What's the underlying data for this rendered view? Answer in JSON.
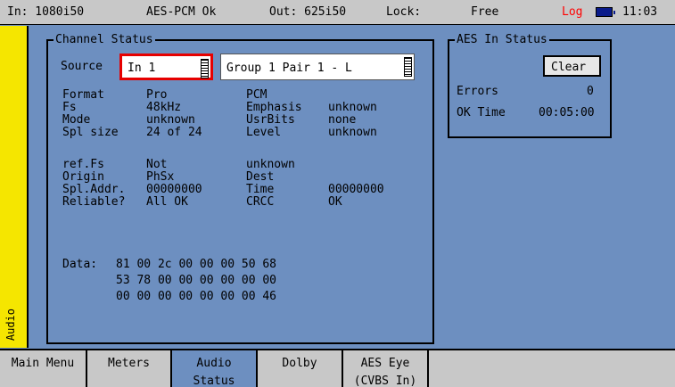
{
  "status_bar": {
    "input": "In: 1080i50",
    "aes": "AES-PCM Ok",
    "output": "Out: 625i50",
    "lock": "Lock:",
    "lock_value": "Free",
    "log": "Log",
    "time": "11:03"
  },
  "side_tab": {
    "label": "Audio"
  },
  "channel_status": {
    "title": "Channel Status",
    "source_label": "Source",
    "source_value": "In 1",
    "group_value": "Group 1 Pair 1 - L",
    "rows": [
      [
        "Format",
        "Pro",
        "PCM",
        ""
      ],
      [
        "Fs",
        "48kHz",
        "Emphasis",
        "unknown"
      ],
      [
        "Mode",
        "unknown",
        "UsrBits",
        "none"
      ],
      [
        "Spl size",
        "24 of 24",
        "Level",
        "unknown"
      ],
      [
        "ref.Fs",
        "Not",
        "unknown",
        ""
      ],
      [
        "Origin",
        "PhSx",
        "Dest",
        ""
      ],
      [
        "Spl.Addr.",
        "00000000",
        "Time",
        "00000000"
      ],
      [
        "Reliable?",
        "All OK",
        "CRCC",
        "OK"
      ]
    ],
    "data_label": "Data:",
    "data_lines": [
      "81 00 2c 00 00 00 50 68",
      "53 78 00 00 00 00 00 00",
      "00 00 00 00 00 00 00 46"
    ]
  },
  "aes_status": {
    "title": "AES In Status",
    "clear_label": "Clear",
    "errors_label": "Errors",
    "errors_value": "0",
    "ok_time_label": "OK Time",
    "ok_time_value": "00:05:00"
  },
  "menu": [
    {
      "line1": "Main Menu",
      "line2": ""
    },
    {
      "line1": "Meters",
      "line2": ""
    },
    {
      "line1": "Audio",
      "line2": "Status"
    },
    {
      "line1": "Dolby",
      "line2": ""
    },
    {
      "line1": "AES Eye",
      "line2": "(CVBS In)"
    }
  ]
}
